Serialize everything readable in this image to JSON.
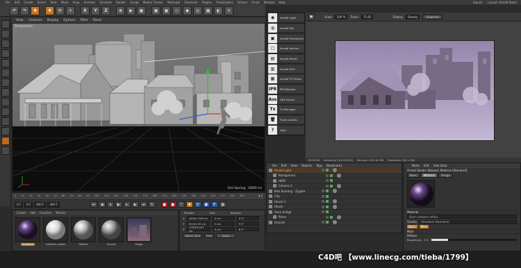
{
  "menu": {
    "items": [
      "File",
      "Edit",
      "Create",
      "Select",
      "Tools",
      "Mesh",
      "Snap",
      "Animate",
      "Simulate",
      "Render",
      "Sculpt",
      "Motion Tracker",
      "MoGraph",
      "Character",
      "Plugins",
      "PlusShaders",
      "Octane",
      "Script",
      "Window",
      "Help"
    ],
    "right": [
      "Expert",
      "Layout: Arnold Room"
    ]
  },
  "toolbar": {
    "buttons": [
      "↶",
      "↷",
      "✥",
      "✥",
      "⟳",
      "✛",
      "X",
      "Y",
      "Z",
      "⊕",
      "▶",
      "▣",
      "▣",
      "▣",
      "◇",
      "◆",
      "◎",
      "▦",
      "◐",
      "☀"
    ]
  },
  "viewport": {
    "menu": [
      "View",
      "Cameras",
      "Display",
      "Options",
      "Filter",
      "Panel"
    ],
    "label": "Perspective",
    "grid_info": "Grid Spacing : 10000 cm"
  },
  "timeline": {
    "ticks": [
      "0",
      "10",
      "20",
      "30",
      "40",
      "50",
      "60",
      "70",
      "80",
      "90",
      "100",
      "110",
      "120",
      "130",
      "140",
      "150",
      "160",
      "170",
      "180",
      "190",
      "200",
      "210",
      "220",
      "230",
      "240",
      "250"
    ],
    "end": "0 F"
  },
  "playback": {
    "start": "0 F",
    "current": "0 F",
    "end": "400 F",
    "max": "400 F"
  },
  "materials": {
    "menu": [
      "Create",
      "Edit",
      "Function",
      "Texture"
    ],
    "items": [
      {
        "name": "Standard",
        "selected": true
      },
      {
        "name": "Lambert_scatter",
        "selected": false
      },
      {
        "name": "Objects",
        "selected": false
      },
      {
        "name": "Ground",
        "selected": false
      },
      {
        "name": "Image",
        "selected": false
      }
    ]
  },
  "coords": {
    "headers": [
      "Position",
      "Size",
      "Rotation"
    ],
    "rows": [
      {
        "axis": "X",
        "pos": "44004.756 cm",
        "size": "0 cm",
        "rot": "H  0°"
      },
      {
        "axis": "Y",
        "pos": "5416.235 cm",
        "size": "0 cm",
        "rot": "P  0°"
      },
      {
        "axis": "Z",
        "pos": "-23035.001 cm",
        "size": "0 cm",
        "rot": "B  0°"
      }
    ],
    "mode": "Object (Rel)",
    "size_mode": "Size",
    "apply": "Apply"
  },
  "arnold": {
    "items": [
      {
        "icon": "◉",
        "label": "Arnold Light"
      },
      {
        "icon": "◍",
        "label": "Arnold Sky"
      },
      {
        "icon": "▣",
        "label": "Arnold Procedural"
      },
      {
        "icon": "▢",
        "label": "Arnold Volume"
      },
      {
        "icon": "▤",
        "label": "Arnold Driver"
      },
      {
        "icon": "▥",
        "label": "Arnold AOV"
      },
      {
        "icon": "▦",
        "label": "Arnold TP Group"
      },
      {
        "icon": "IPR",
        "label": "IPR Window"
      },
      {
        "icon": "Ass",
        "label": "ASS Export"
      },
      {
        "icon": "Tx",
        "label": "Tx Manager"
      },
      {
        "icon": "🗑",
        "label": "Flush caches"
      },
      {
        "icon": "?",
        "label": "Help"
      }
    ]
  },
  "render_view": {
    "scale_label": "Scale",
    "scale_value": "100 %",
    "zoom_label": "Zoom",
    "zoom_value": "75.65",
    "display_label": "Display",
    "display_value": "Beauty",
    "snapshot": "Snapshot",
    "status": [
      "00:00:06",
      "Sampling: [3/2/2/2/2/2]",
      "Memory: 1252.41 MB",
      "Resolution: 500 x 400"
    ]
  },
  "objects": {
    "menu": [
      "File",
      "Edit",
      "View",
      "Objects",
      "Tags",
      "Bookmarks"
    ],
    "rows": [
      {
        "name": "Arnold Light",
        "selected": true,
        "indent": 0
      },
      {
        "name": "Background",
        "selected": false,
        "indent": 1
      },
      {
        "name": "HDRI",
        "selected": false,
        "indent": 1
      },
      {
        "name": "Camera.1",
        "selected": false,
        "indent": 1
      },
      {
        "name": "Man Running - Zygote",
        "selected": false,
        "indent": 0
      },
      {
        "name": "City",
        "selected": false,
        "indent": 0
      },
      {
        "name": "House 1",
        "selected": false,
        "indent": 0
      },
      {
        "name": "House",
        "selected": false,
        "indent": 0
      },
      {
        "name": "Alum bridge",
        "selected": false,
        "indent": 0
      },
      {
        "name": "Plane",
        "selected": false,
        "indent": 1
      },
      {
        "name": "Ground",
        "selected": false,
        "indent": 0
      }
    ]
  },
  "attributes": {
    "menu": [
      "Mode",
      "Edit",
      "User Data"
    ],
    "title": "Arnold Shader Network Material [Standard]",
    "tabs": [
      "Basic",
      "Material",
      "Assign"
    ],
    "section_material": "Material",
    "open_button": "Open network editor...",
    "shader_label": "Shader",
    "shader_value": "Standard (Standard)",
    "basic_tag": "Basic",
    "main_tag": "Main",
    "diffuse_label": "Diffuse",
    "roughness_label": "Roughness",
    "roughness_value": "0.2"
  },
  "watermark": {
    "text": "C4D吧 【www.linecg.com/tieba/1799】"
  }
}
